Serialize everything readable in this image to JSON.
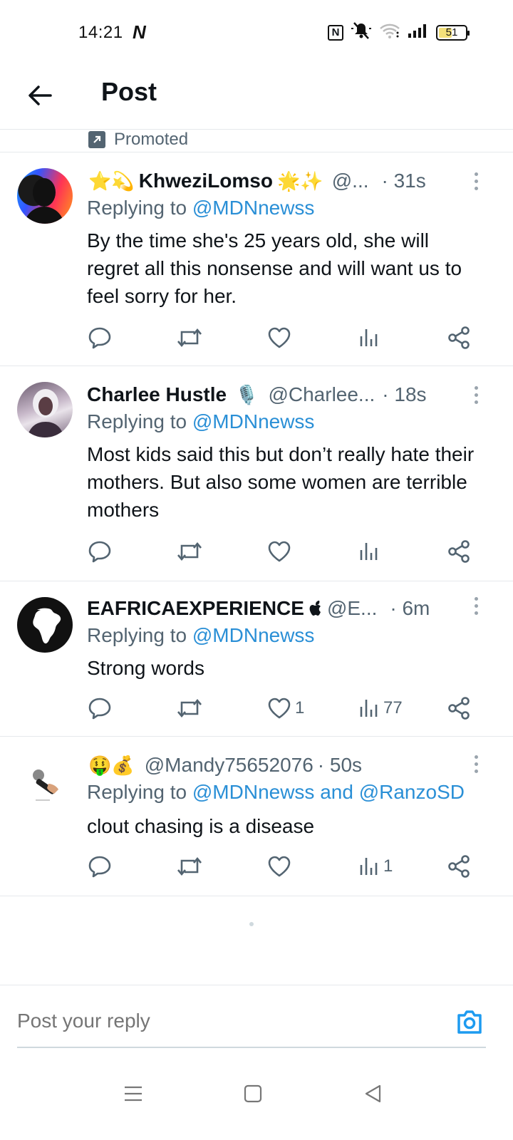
{
  "status_bar": {
    "time": "14:21",
    "notification_glyph": "N",
    "nfc_label": "N",
    "battery_level": "51",
    "battery_fraction": 0.51,
    "icons": [
      "nfc-icon",
      "mute-icon",
      "wifi-icon",
      "signal-icon",
      "battery-icon"
    ]
  },
  "header": {
    "title": "Post",
    "back_icon": "arrow-left-icon"
  },
  "promoted": {
    "label": "Promoted"
  },
  "composer": {
    "placeholder": "Post your reply",
    "camera_icon": "camera-icon"
  },
  "colors": {
    "accent": "#1d9bf0",
    "mention": "#2a8fd6",
    "muted": "#536471",
    "divider": "#e6e9ec"
  },
  "replies": [
    {
      "name": "KhweziLomso",
      "emoji_before": "⭐💫",
      "emoji_after": "🌟✨",
      "handle": "@...",
      "time": "· 31s",
      "replying_prefix": "Replying to",
      "mentions": "@MDNnewss",
      "text": "By the time she's 25 years old, she will regret all this nonsense and will want us to feel sorry for her.",
      "likes": "",
      "views": ""
    },
    {
      "name": "Charlee Hustle",
      "emoji_before": "",
      "emoji_after": "🎙️",
      "handle": "@Charlee...",
      "time": "· 18s",
      "replying_prefix": "Replying to",
      "mentions": "@MDNnewss",
      "text": "Most kids said this but don’t really hate their mothers. But also some women are terrible mothers",
      "likes": "",
      "views": ""
    },
    {
      "name": "EAFRICAEXPERIENCE",
      "emoji_before": "",
      "emoji_after": "",
      "handle": "@E...",
      "time": "· 6m",
      "replying_prefix": "Replying to",
      "mentions": "@MDNnewss",
      "text": "Strong words",
      "likes": "1",
      "views": "77"
    },
    {
      "name": "",
      "emoji_before": "🤑💰",
      "emoji_after": "",
      "handle": "@Mandy75652076",
      "time": "· 50s",
      "replying_prefix": "Replying to",
      "mentions": "@MDNnewss and @RanzoSD",
      "text": "clout chasing is a disease",
      "likes": "",
      "views": "1"
    }
  ],
  "navbar": {
    "icons": [
      "recents-icon",
      "home-icon",
      "back-icon"
    ]
  }
}
